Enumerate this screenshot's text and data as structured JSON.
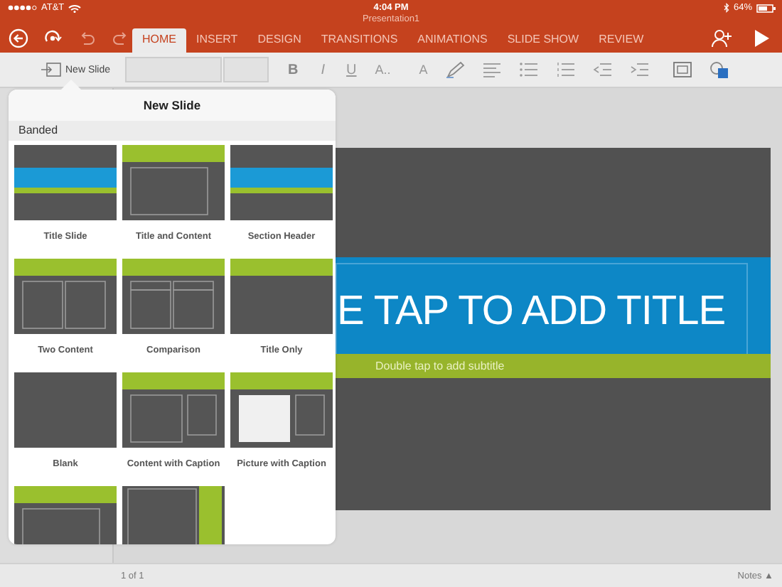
{
  "status_bar": {
    "carrier": "AT&T",
    "time": "4:04 PM",
    "battery": "64%"
  },
  "document_title": "Presentation1",
  "ribbon_tabs": [
    {
      "label": "HOME",
      "selected": true
    },
    {
      "label": "INSERT",
      "selected": false
    },
    {
      "label": "DESIGN",
      "selected": false
    },
    {
      "label": "TRANSITIONS",
      "selected": false
    },
    {
      "label": "ANIMATIONS",
      "selected": false
    },
    {
      "label": "SLIDE SHOW",
      "selected": false
    },
    {
      "label": "REVIEW",
      "selected": false
    }
  ],
  "toolbar": {
    "new_slide": "New Slide",
    "format_buttons": [
      "B",
      "I",
      "U",
      "A..",
      "A"
    ]
  },
  "popover": {
    "title": "New Slide",
    "section": "Banded",
    "layouts": [
      {
        "kind": "title",
        "label": "Title Slide"
      },
      {
        "kind": "title-content",
        "label": "Title and Content"
      },
      {
        "kind": "title",
        "label": "Section Header"
      },
      {
        "kind": "two-content",
        "label": "Two Content"
      },
      {
        "kind": "comparison",
        "label": "Comparison"
      },
      {
        "kind": "title-only",
        "label": "Title Only"
      },
      {
        "kind": "blank",
        "label": "Blank"
      },
      {
        "kind": "content-caption",
        "label": "Content with Caption"
      },
      {
        "kind": "picture-caption",
        "label": "Picture with Caption"
      },
      {
        "kind": "title-content"
      },
      {
        "kind": "vertical"
      }
    ]
  },
  "slide": {
    "title": "E TAP TO ADD TITLE",
    "subtitle": "Double tap to add subtitle"
  },
  "footer": {
    "page": "1 of 1",
    "notes": "Notes ▲"
  }
}
